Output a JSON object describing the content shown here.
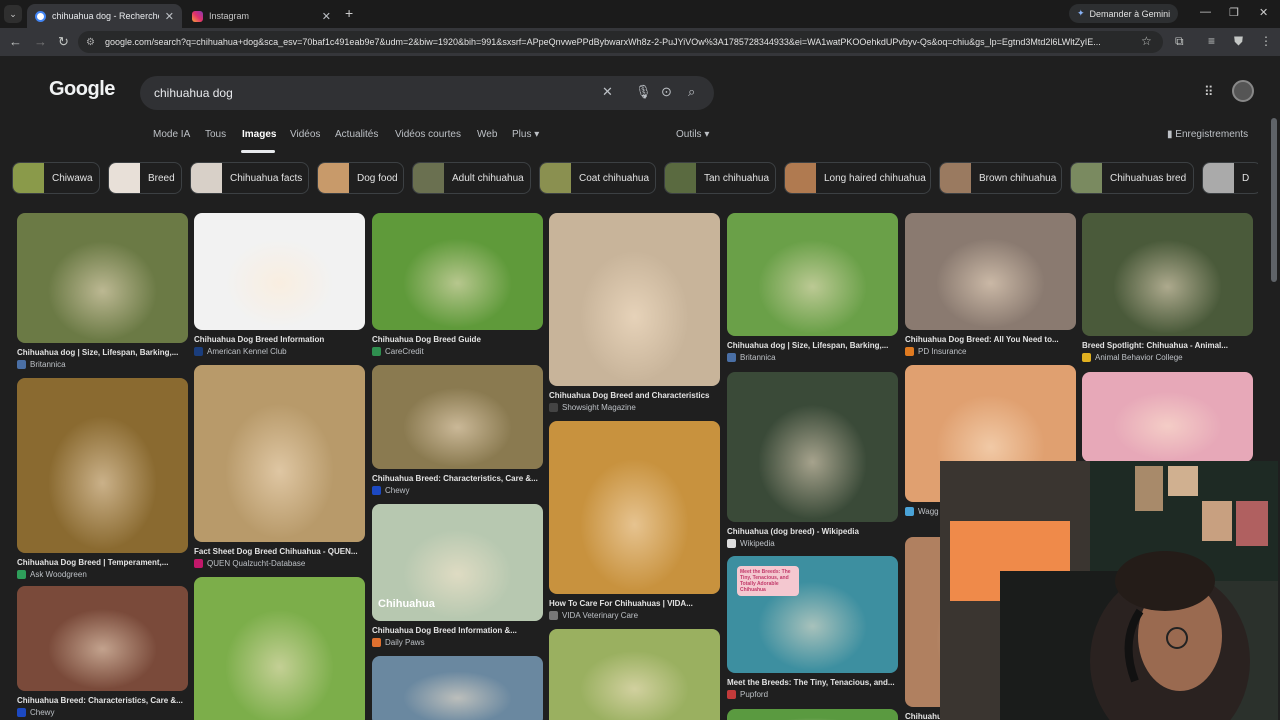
{
  "browser": {
    "tabs": [
      {
        "label": "chihuahua dog - Recherche Go",
        "active": true,
        "favicon_color": "#4285f4"
      },
      {
        "label": "Instagram",
        "active": false,
        "favicon_color": "#e1306c"
      }
    ],
    "gemini_label": "Demander à Gemini",
    "url": "google.com/search?q=chihuahua+dog&sca_esv=70baf1c491eab9e7&udm=2&biw=1920&bih=991&sxsrf=APpeQnvwePPdBybwarxWh8z-2-PuJYiVOw%3A1785728344933&ei=WA1watPKOOehkdUPvbyv-Qs&oq=chiu&gs_lp=Egtnd3Mtd2l6LWltZyIE..."
  },
  "google": {
    "logo": "Google",
    "query": "chihuahua dog",
    "tabs": [
      "Mode IA",
      "Tous",
      "Images",
      "Vidéos",
      "Actualités",
      "Vidéos courtes",
      "Web",
      "Plus"
    ],
    "active_tab": "Images",
    "tools_label": "Outils",
    "saved_label": "Enregistrements",
    "chips": [
      "Chiwawa",
      "Breed",
      "Chihuahua facts",
      "Dog food",
      "Adult chihuahua",
      "Coat chihuahua",
      "Tan chihuahua",
      "Long haired chihuahua",
      "Brown chihuahua",
      "Chihuahuas bred",
      "D"
    ],
    "results": [
      {
        "title": "Chihuahua dog | Size, Lifespan, Barking,...",
        "source": "Britannica",
        "img_color": "#6b7a45",
        "fav_color": "#4a6fa5"
      },
      {
        "title": "Chihuahua Dog Breed | Temperament,...",
        "source": "Ask Woodgreen",
        "img_color": "#8a6a30",
        "fav_color": "#2e9e5a"
      },
      {
        "title": "Chihuahua Breed: Characteristics, Care &...",
        "source": "Chewy",
        "img_color": "#7a4a3a",
        "fav_color": "#1c49c2"
      },
      {
        "title": "Chihuahua Dog Breed Information",
        "source": "American Kennel Club",
        "img_color": "#f2f2f2",
        "fav_color": "#1a3d7c"
      },
      {
        "title": "Fact Sheet Dog Breed Chihuahua - QUEN...",
        "source": "QUEN Qualzucht-Database",
        "img_color": "#b89a6a",
        "fav_color": "#c2186a"
      },
      {
        "title": "",
        "source": "",
        "img_color": "#7cae4a",
        "fav_color": "#666"
      },
      {
        "title": "Chihuahua Dog Breed Guide",
        "source": "CareCredit",
        "img_color": "#5f9a3a",
        "fav_color": "#2f8f4f"
      },
      {
        "title": "Chihuahua Breed: Characteristics, Care &...",
        "source": "Chewy",
        "img_color": "#8a7a50",
        "fav_color": "#1c49c2"
      },
      {
        "title": "Chihuahua Dog Breed Information &...",
        "source": "Daily Paws",
        "img_color": "#b7c8b0",
        "fav_color": "#e0702f"
      },
      {
        "title": "",
        "source": "",
        "img_color": "#6a88a0",
        "fav_color": "#666"
      },
      {
        "title": "Chihuahua Dog Breed and Characteristics",
        "source": "Showsight Magazine",
        "img_color": "#c8b49a",
        "fav_color": "#444"
      },
      {
        "title": "How To Care For Chihuahuas | VIDA...",
        "source": "VIDA Veterinary Care",
        "img_color": "#c8923e",
        "fav_color": "#777"
      },
      {
        "title": "",
        "source": "",
        "img_color": "#9ab060",
        "fav_color": "#666"
      },
      {
        "title": "Chihuahua dog | Size, Lifespan, Barking,...",
        "source": "Britannica",
        "img_color": "#6aa048",
        "fav_color": "#4a6fa5"
      },
      {
        "title": "Chihuahua (dog breed) - Wikipedia",
        "source": "Wikipedia",
        "img_color": "#3a4a38",
        "fav_color": "#ddd"
      },
      {
        "title": "Meet the Breeds: The Tiny, Tenacious, and...",
        "source": "Pupford",
        "img_color": "#3d8fa0",
        "fav_color": "#c23a3a"
      },
      {
        "title": "",
        "source": "",
        "img_color": "#5a9a40",
        "fav_color": "#666"
      },
      {
        "title": "Chihuahua Dog Breed: All You Need to...",
        "source": "PD Insurance",
        "img_color": "#8a7a70",
        "fav_color": "#e07a20"
      },
      {
        "title": "",
        "source": "Wagg",
        "img_color": "#e0a070",
        "fav_color": "#4aa3d8"
      },
      {
        "title": "Chihuahua Puppy Care: What New Owners...",
        "source": "",
        "img_color": "#b08060",
        "fav_color": "#666"
      },
      {
        "title": "Breed Spotlight: Chihuahua - Animal...",
        "source": "Animal Behavior College",
        "img_color": "#4a5a3a",
        "fav_color": "#e0b020"
      },
      {
        "title": "",
        "source": "",
        "img_color": "#e7a8b8",
        "fav_color": "#666"
      }
    ],
    "daily_paws_overlay": "Chihuahua",
    "pupford_overlay": "Meet the Breeds: The Tiny, Tenacious, and Totally Adorable Chihuahua"
  }
}
